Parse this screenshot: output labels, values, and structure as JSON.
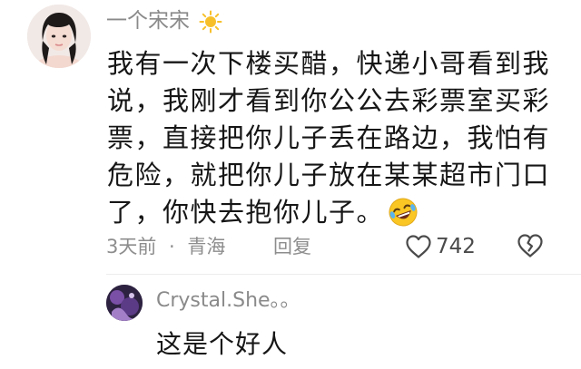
{
  "comment": {
    "username": "一个宋宋",
    "username_icon": "sun-icon",
    "text_lines": [
      "我有一次下楼买醋，快递小哥看到我",
      "说，我刚才看到你公公去彩票室买彩",
      "票，直接把你儿子丢在路边，我怕有",
      "危险，就把你儿子放在某某超市门口",
      "了，你快去抱你儿子。"
    ],
    "emoji": "rolling-on-floor-laughing-emoji",
    "time": "3天前",
    "separator": "·",
    "location": "青海",
    "reply_label": "回复",
    "like_count": "742",
    "like_icon": "heart-icon",
    "dislike_icon": "broken-heart-icon"
  },
  "reply": {
    "username": "Crystal.She。。",
    "text": "这是个好人"
  },
  "colors": {
    "text_primary": "#161616",
    "text_secondary": "#8d8d8d",
    "sun": "#f7c02b",
    "emoji_face": "#f9c623"
  }
}
